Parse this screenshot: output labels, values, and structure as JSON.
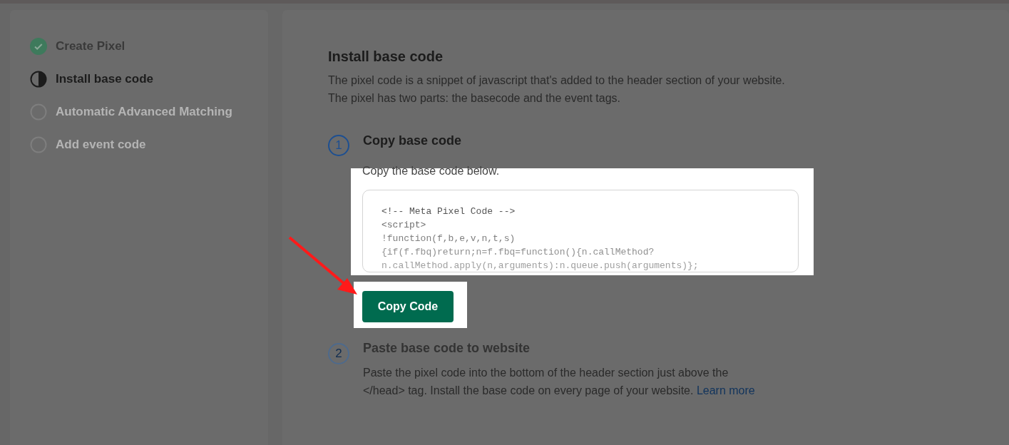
{
  "steps": [
    {
      "label": "Create Pixel",
      "completed": true,
      "current": false
    },
    {
      "label": "Install base code",
      "completed": false,
      "current": true
    },
    {
      "label": "Automatic Advanced Matching",
      "completed": false,
      "current": false
    },
    {
      "label": "Add event code",
      "completed": false,
      "current": false
    }
  ],
  "content": {
    "title": "Install base code",
    "description": [
      "The pixel code is a snippet of javascript that's added to the header section of your website.",
      "The pixel has two parts: the basecode and the event tags."
    ],
    "step_1": {
      "number": "1",
      "title": "Copy base code",
      "hint": "Copy the base code below.",
      "code_lines": [
        "<!-- Meta Pixel Code -->",
        "<script>",
        "!function(f,b,e,v,n,t,s)",
        "{if(f.fbq)return;n=f.fbq=function(){n.callMethod?",
        "n.callMethod.apply(n,arguments):n.queue.push(arguments)};"
      ],
      "button": "Copy Code"
    },
    "step_2": {
      "number": "2",
      "title": "Paste base code to website",
      "text": "Paste the pixel code into the bottom of the header section just above the </head> tag. Install the base code on every page of your website.",
      "link": "Learn more"
    }
  }
}
